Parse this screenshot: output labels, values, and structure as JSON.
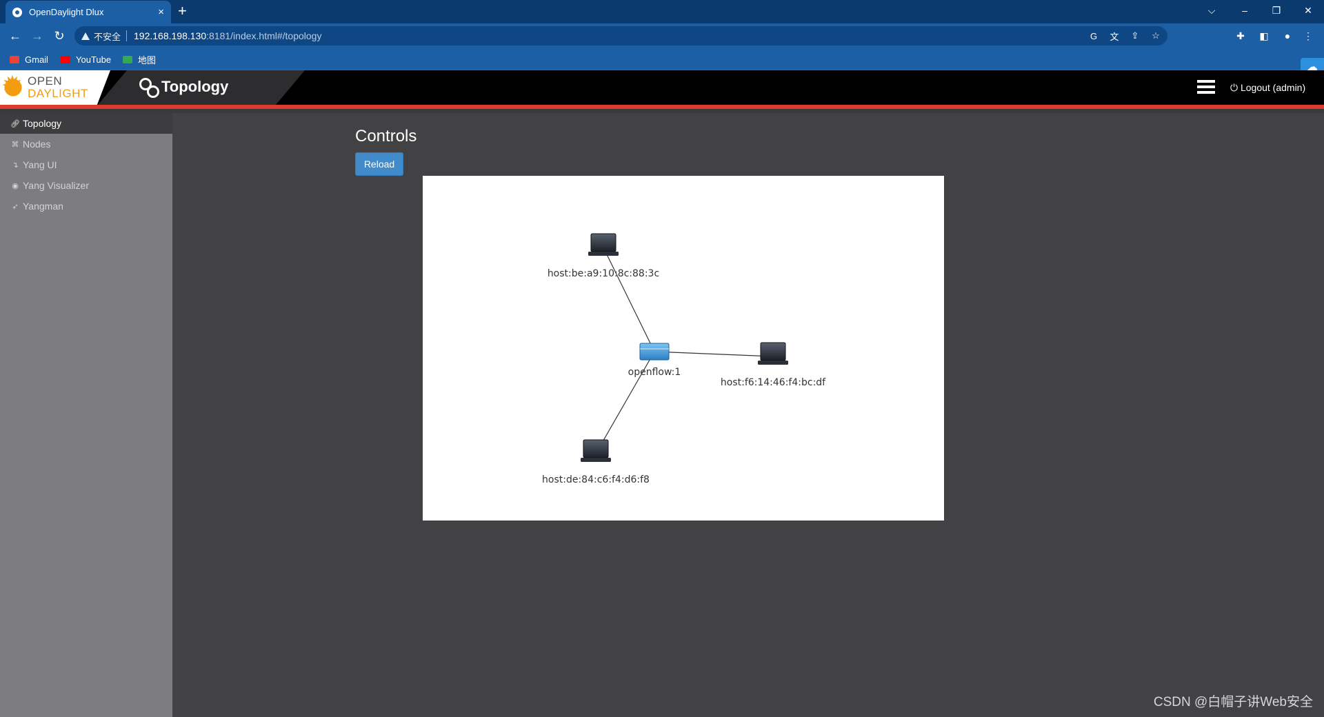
{
  "browser": {
    "tab_title": "OpenDaylight Dlux",
    "tab_close": "×",
    "new_tab": "+",
    "insecure_label": "不安全",
    "url_host": "192.168.198.130",
    "url_rest": ":8181/index.html#/topology",
    "bookmarks": [
      {
        "label": "Gmail",
        "color": "#ea4335"
      },
      {
        "label": "YouTube",
        "color": "#ff0000"
      },
      {
        "label": "地图",
        "color": "#34a853"
      }
    ],
    "window_controls": {
      "menu": "⌵",
      "minimize": "–",
      "restore": "❐",
      "close": "✕"
    }
  },
  "app": {
    "logo_line1": "OPEN",
    "logo_line2": "DAYLIGHT",
    "title": "Topology",
    "logout_label": "⏻ Logout (admin)",
    "accent_color": "#e03a2f"
  },
  "sidebar": {
    "items": [
      {
        "label": "Topology",
        "icon": "link-icon",
        "glyph": "🔗︎",
        "active": true
      },
      {
        "label": "Nodes",
        "icon": "sitemap-icon",
        "glyph": "⌘",
        "active": false
      },
      {
        "label": "Yang UI",
        "icon": "level-down-icon",
        "glyph": "↴",
        "active": false
      },
      {
        "label": "Yang Visualizer",
        "icon": "eye-icon",
        "glyph": "◉",
        "active": false
      },
      {
        "label": "Yangman",
        "icon": "rocket-icon",
        "glyph": "➶",
        "active": false
      }
    ]
  },
  "main": {
    "controls_title": "Controls",
    "reload_label": "Reload"
  },
  "topology": {
    "nodes": [
      {
        "id": "switch",
        "label": "openflow:1",
        "type": "switch"
      },
      {
        "id": "h1",
        "label": "host:be:a9:10:8c:88:3c",
        "type": "host"
      },
      {
        "id": "h2",
        "label": "host:f6:14:46:f4:bc:df",
        "type": "host"
      },
      {
        "id": "h3",
        "label": "host:de:84:c6:f4:d6:f8",
        "type": "host"
      }
    ],
    "links": [
      {
        "source": "switch",
        "target": "h1"
      },
      {
        "source": "switch",
        "target": "h2"
      },
      {
        "source": "switch",
        "target": "h3"
      }
    ]
  },
  "watermark": "CSDN @白帽子讲Web安全"
}
